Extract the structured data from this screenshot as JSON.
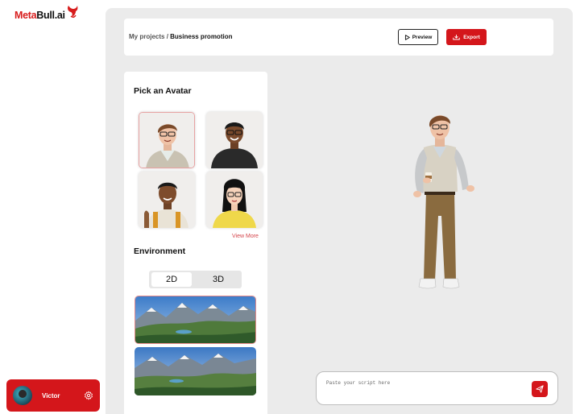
{
  "brand": {
    "name_part1": "Meta",
    "name_part2": "Bull.ai",
    "accent_color": "#d4161b"
  },
  "user": {
    "name": "Victor",
    "settings_icon": "gear-icon"
  },
  "header": {
    "breadcrumb_parent": "My projects",
    "breadcrumb_separator": " / ",
    "breadcrumb_current": "Business promotion",
    "preview_label": "Preview",
    "export_label": "Export"
  },
  "avatar_section": {
    "title": "Pick an Avatar",
    "view_more": "View More",
    "avatars": [
      {
        "selected": true
      },
      {
        "selected": false
      },
      {
        "selected": false
      },
      {
        "selected": false
      }
    ]
  },
  "environment_section": {
    "title": "Environment",
    "mode_options": [
      "2D",
      "3D"
    ],
    "selected_mode": "2D",
    "backgrounds": [
      {
        "selected": true
      },
      {
        "selected": false
      }
    ]
  },
  "script": {
    "placeholder": "Paste your script here",
    "send_icon": "send-icon"
  }
}
